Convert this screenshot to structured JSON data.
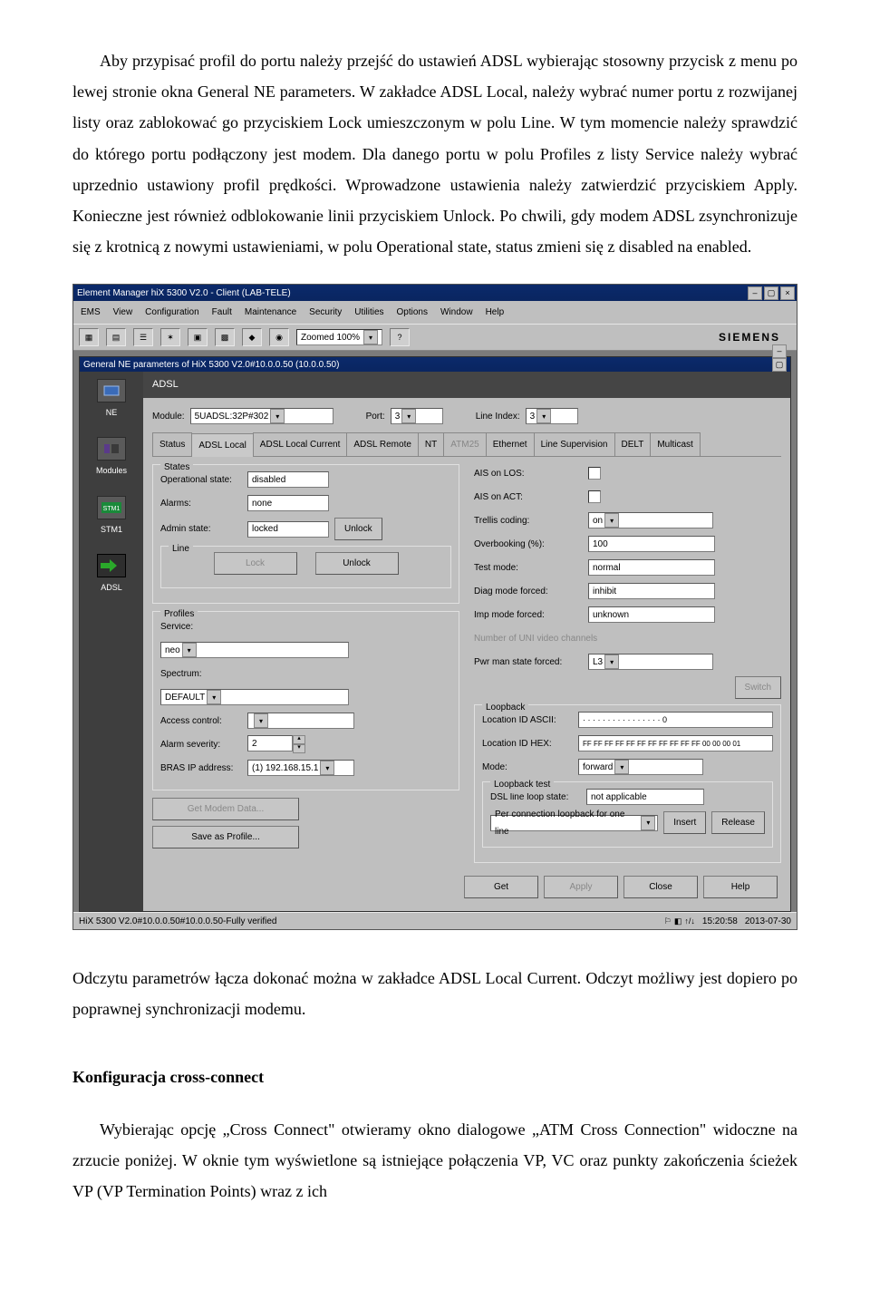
{
  "doc": {
    "p1": "Aby przypisać profil do portu należy przejść do ustawień ADSL wybierając stosowny przycisk z menu po lewej stronie okna General NE parameters. W zakładce ADSL Local, należy wybrać numer portu z rozwijanej listy oraz zablokować go przyciskiem Lock umieszczonym w polu Line. W tym momencie należy sprawdzić do którego portu podłączony jest modem. Dla danego portu w polu Profiles z listy Service należy wybrać uprzednio ustawiony profil prędkości. Wprowadzone ustawienia należy zatwierdzić przyciskiem Apply. Konieczne jest również odblokowanie linii przyciskiem Unlock. Po chwili, gdy modem ADSL zsynchronizuje się z krotnicą z nowymi ustawieniami, w polu Operational state, status zmieni się z disabled na enabled.",
    "p2": "Odczytu parametrów łącza dokonać można w zakładce ADSL Local Current. Odczyt możliwy jest dopiero po poprawnej synchronizacji modemu.",
    "h": "Konfiguracja cross-connect",
    "p3": "Wybierając opcję „Cross Connect\" otwieramy okno dialogowe „ATM Cross Connection\" widoczne na zrzucie poniżej. W oknie tym wyświetlone są istniejące połączenia VP, VC oraz punkty zakończenia ścieżek VP (VP Termination Points) wraz z ich"
  },
  "ui": {
    "app_title": "Element Manager hiX 5300 V2.0 - Client (LAB-TELE)",
    "menu": [
      "EMS",
      "View",
      "Configuration",
      "Fault",
      "Maintenance",
      "Security",
      "Utilities",
      "Options",
      "Window",
      "Help"
    ],
    "zoom": "Zoomed 100%",
    "brand": "SIEMENS",
    "child_title": "General NE parameters of HiX 5300 V2.0#10.0.0.50 (10.0.0.50)",
    "sidebar": {
      "ne": "NE",
      "modules": "Modules",
      "stm1": "STM1",
      "adsl": "ADSL"
    },
    "adsl": {
      "title": "ADSL",
      "module_label": "Module:",
      "module_value": "5UADSL:32P#302",
      "port_label": "Port:",
      "port_value": "3",
      "line_label": "Line Index:",
      "line_value": "3",
      "tabs": [
        "Status",
        "ADSL Local",
        "ADSL Local Current",
        "ADSL Remote",
        "NT",
        "ATM25",
        "Ethernet",
        "Line Supervision",
        "DELT",
        "Multicast"
      ],
      "states_legend": "States",
      "op_label": "Operational state:",
      "op_value": "disabled",
      "alarms_label": "Alarms:",
      "alarms_value": "none",
      "admin_label": "Admin state:",
      "admin_value": "locked",
      "unlock_btn1": "Unlock",
      "line_legend": "Line",
      "lock_btn": "Lock",
      "unlock_btn2": "Unlock",
      "profiles_legend": "Profiles",
      "service_label": "Service:",
      "service_value": "neo",
      "spectrum_label": "Spectrum:",
      "spectrum_value": "DEFAULT",
      "access_label": "Access control:",
      "alarmsev_label": "Alarm severity:",
      "alarmsev_value": "2",
      "bras_label": "BRAS IP address:",
      "bras_value": "(1) 192.168.15.1",
      "get_modem": "Get Modem Data...",
      "save_profile": "Save as Profile...",
      "ais_los": "AIS on LOS:",
      "ais_act": "AIS on ACT:",
      "trellis": "Trellis coding:",
      "trellis_value": "on",
      "overbook": "Overbooking (%):",
      "overbook_value": "100",
      "testmode": "Test mode:",
      "testmode_value": "normal",
      "diag": "Diag mode forced:",
      "diag_value": "inhibit",
      "imp": "Imp mode forced:",
      "imp_value": "unknown",
      "uni": "Number of UNI video channels",
      "pwr": "Pwr man state forced:",
      "pwr_value": "L3",
      "switch_btn": "Switch",
      "loopback_legend": "Loopback",
      "loc_ascii": "Location ID ASCII:",
      "loc_ascii_value": "· · · · · · · · · · · · · · · ·   0",
      "loc_hex": "Location ID  HEX:",
      "loc_hex_value": "FF FF FF FF FF FF FF FF FF FF FF 00 00 00 01",
      "loop_mode": "Mode:",
      "loop_mode_value": "forward",
      "loop_test_legend": "Loopback test",
      "dsl_state": "DSL line loop state:",
      "dsl_state_value": "not applicable",
      "per_conn": "Per connection loopback for one line",
      "insert": "Insert",
      "release": "Release",
      "get": "Get",
      "apply": "Apply",
      "close": "Close",
      "help": "Help"
    },
    "statusbar": {
      "left": "HiX 5300 V2.0#10.0.0.50#10.0.0.50-Fully verified",
      "time": "15:20:58",
      "date": "2013-07-30"
    }
  }
}
